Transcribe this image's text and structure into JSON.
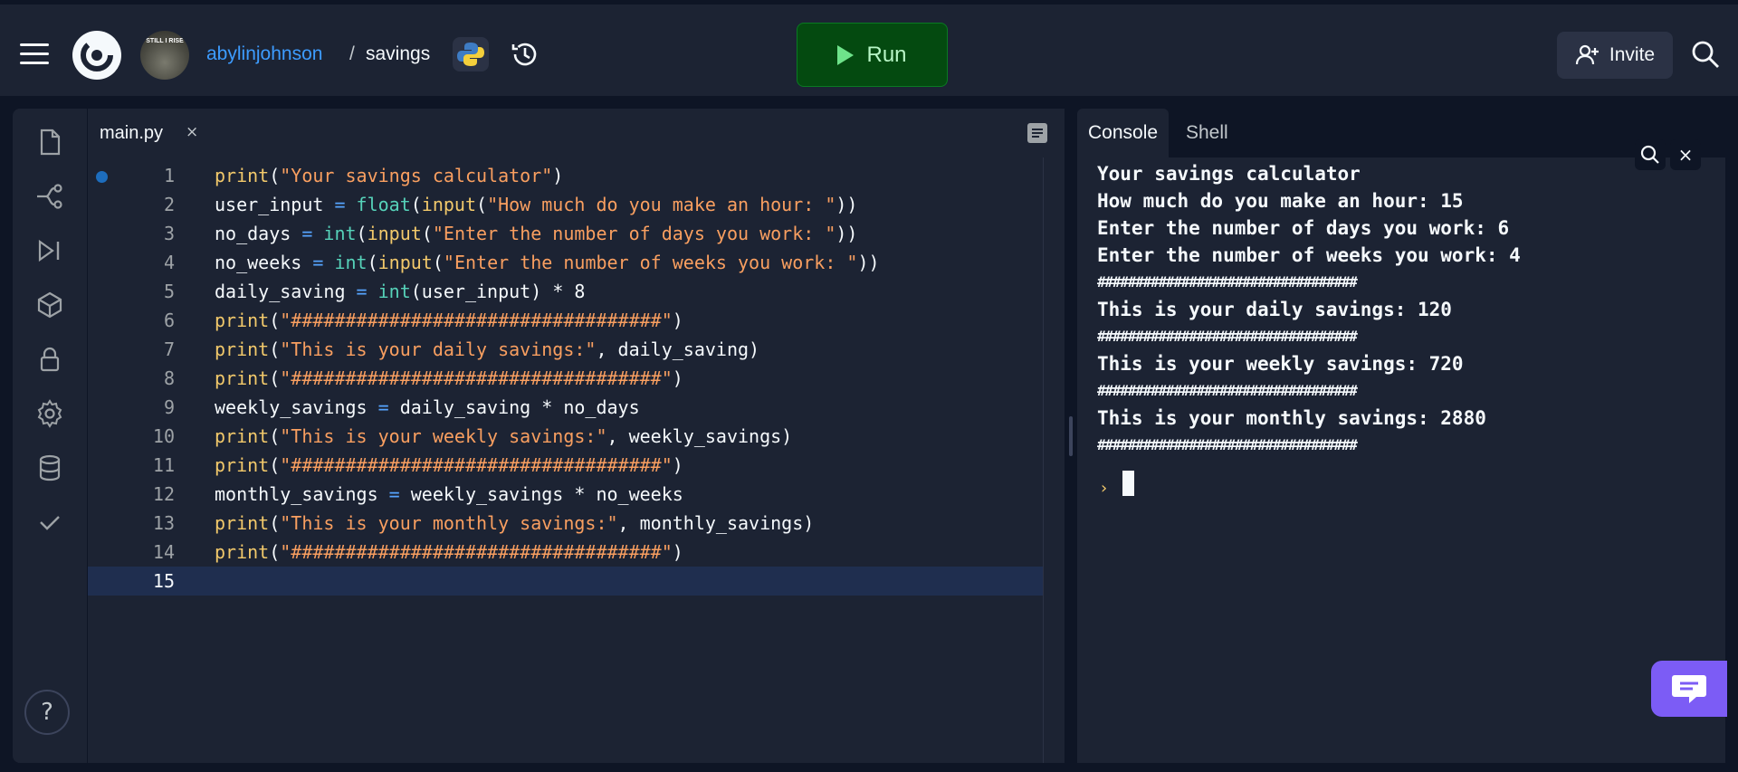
{
  "header": {
    "avatar_text": "STILL I RISE",
    "repo_owner": "abylinjohnson",
    "separator": "/",
    "repo_name": "savings",
    "run_label": "Run",
    "invite_label": "Invite"
  },
  "editor": {
    "tab_label": "main.py",
    "tab_close": "×",
    "current_line": 15,
    "lines": [
      {
        "num": "1"
      },
      {
        "num": "2"
      },
      {
        "num": "3"
      },
      {
        "num": "4"
      },
      {
        "num": "5"
      },
      {
        "num": "6"
      },
      {
        "num": "7"
      },
      {
        "num": "8"
      },
      {
        "num": "9"
      },
      {
        "num": "10"
      },
      {
        "num": "11"
      },
      {
        "num": "12"
      },
      {
        "num": "13"
      },
      {
        "num": "14"
      },
      {
        "num": "15"
      }
    ],
    "code": {
      "l1": {
        "a": "print",
        "b": "(",
        "c": "\"Your savings calculator\"",
        "d": ")"
      },
      "l2": {
        "a": "user_input ",
        "b": "=",
        "c": " float",
        "d": "(",
        "e": "input",
        "f": "(",
        "g": "\"How much do you make an hour: \"",
        "h": "))"
      },
      "l3": {
        "a": "no_days ",
        "b": "=",
        "c": " int",
        "d": "(",
        "e": "input",
        "f": "(",
        "g": "\"Enter the number of days you work: \"",
        "h": "))"
      },
      "l4": {
        "a": "no_weeks ",
        "b": "=",
        "c": " int",
        "d": "(",
        "e": "input",
        "f": "(",
        "g": "\"Enter the number of weeks you work: \"",
        "h": "))"
      },
      "l5": {
        "a": "daily_saving ",
        "b": "=",
        "c": " int",
        "d": "(user_input) ",
        "e": "*",
        "f": " 8"
      },
      "l6": {
        "a": "print",
        "b": "(",
        "c": "\"##################################\"",
        "d": ")"
      },
      "l7": {
        "a": "print",
        "b": "(",
        "c": "\"This is your daily savings:\"",
        "d": ", daily_saving)"
      },
      "l8": {
        "a": "print",
        "b": "(",
        "c": "\"##################################\"",
        "d": ")"
      },
      "l9": {
        "a": "weekly_savings ",
        "b": "=",
        "c": " daily_saving ",
        "d": "*",
        "e": " no_days"
      },
      "l10": {
        "a": "print",
        "b": "(",
        "c": "\"This is your weekly savings:\"",
        "d": ", weekly_savings)"
      },
      "l11": {
        "a": "print",
        "b": "(",
        "c": "\"##################################\"",
        "d": ")"
      },
      "l12": {
        "a": "monthly_savings ",
        "b": "=",
        "c": " weekly_savings ",
        "d": "*",
        "e": " no_weeks"
      },
      "l13": {
        "a": "print",
        "b": "(",
        "c": "\"This is your monthly savings:\"",
        "d": ", monthly_savings)"
      },
      "l14": {
        "a": "print",
        "b": "(",
        "c": "\"##################################\"",
        "d": ")"
      }
    }
  },
  "console": {
    "tabs": [
      "Console",
      "Shell"
    ],
    "close_glyph": "×",
    "output": [
      "Your savings calculator",
      "How much do you make an hour: 15",
      "Enter the number of days you work: 6",
      "Enter the number of weeks you work: 4",
      "##################################",
      "This is your daily savings: 120",
      "##################################",
      "This is your weekly savings: 720",
      "##################################",
      "This is your monthly savings: 2880",
      "##################################"
    ],
    "prompt": "›"
  },
  "help_label": "?",
  "icons": {
    "menu": "hamburger-icon",
    "logo": "replit-logo-icon",
    "language": "python-icon",
    "history": "history-icon",
    "run": "play-icon",
    "invite": "add-user-icon",
    "search": "search-icon",
    "rail": [
      "files-icon",
      "git-icon",
      "debugger-icon",
      "packages-icon",
      "secrets-icon",
      "settings-icon",
      "database-icon",
      "check-icon"
    ],
    "chat": "chat-icon"
  },
  "colors": {
    "run_button": "#044a10",
    "accent_blue": "#3d9cff",
    "chat_fab": "#7c5cf5"
  }
}
